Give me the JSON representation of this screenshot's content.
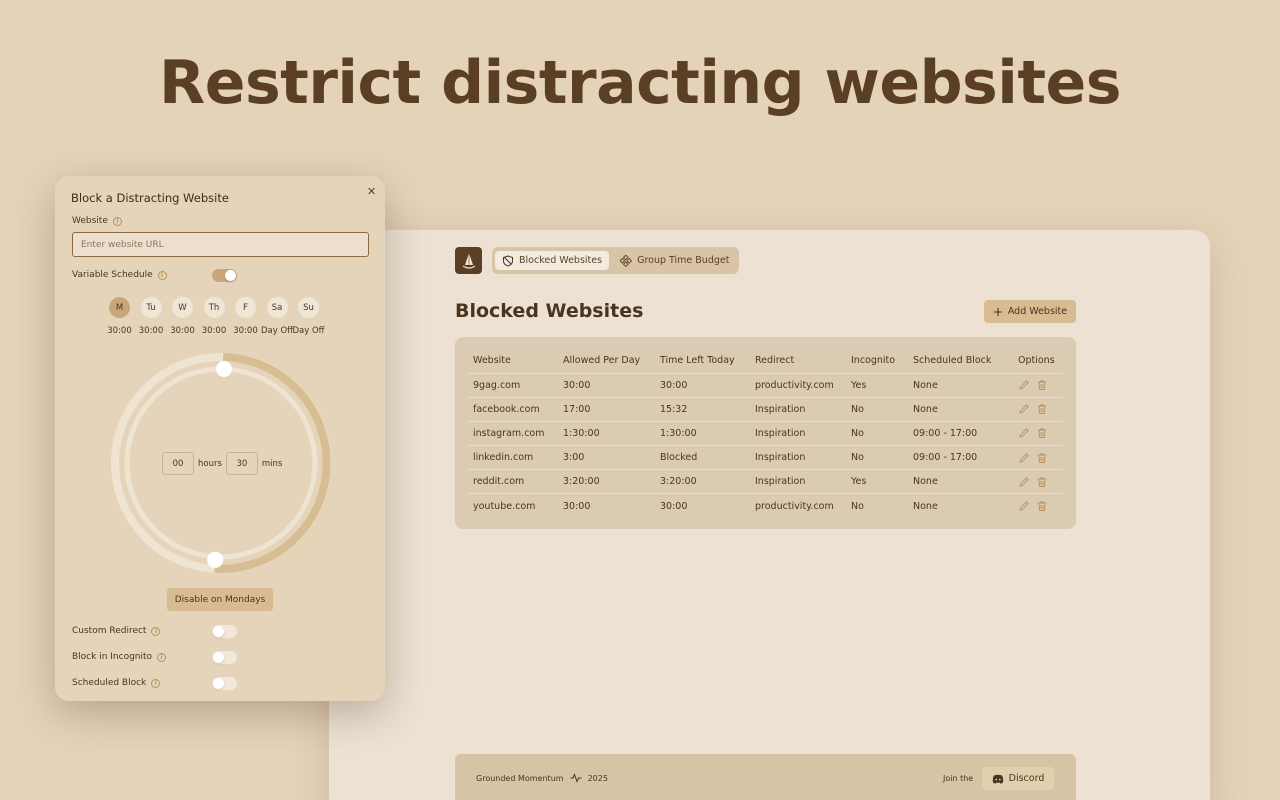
{
  "headline": "Restrict distracting websites",
  "nav": {
    "tabs": [
      {
        "label": "Blocked Websites",
        "icon": "shield-icon",
        "active": true
      },
      {
        "label": "Group Time Budget",
        "icon": "group-icon",
        "active": false
      }
    ]
  },
  "main": {
    "title": "Blocked Websites",
    "add_label": "Add Website",
    "table": {
      "headers": [
        "Website",
        "Allowed Per Day",
        "Time Left Today",
        "Redirect",
        "Incognito",
        "Scheduled Block",
        "Options"
      ],
      "rows": [
        [
          "9gag.com",
          "30:00",
          "30:00",
          "productivity.com",
          "Yes",
          "None"
        ],
        [
          "facebook.com",
          "17:00",
          "15:32",
          "Inspiration",
          "No",
          "None"
        ],
        [
          "instagram.com",
          "1:30:00",
          "1:30:00",
          "Inspiration",
          "No",
          "09:00 - 17:00"
        ],
        [
          "linkedin.com",
          "3:00",
          "Blocked",
          "Inspiration",
          "No",
          "09:00 - 17:00"
        ],
        [
          "reddit.com",
          "3:20:00",
          "3:20:00",
          "Inspiration",
          "Yes",
          "None"
        ],
        [
          "youtube.com",
          "30:00",
          "30:00",
          "productivity.com",
          "No",
          "None"
        ]
      ]
    }
  },
  "footer": {
    "brand": "Grounded Momentum",
    "year": "2025",
    "join": "Join the",
    "discord": "Discord"
  },
  "modal": {
    "title": "Block a Distracting Website",
    "website_label": "Website",
    "website_placeholder": "Enter website URL",
    "variable_schedule_label": "Variable Schedule",
    "variable_schedule_on": true,
    "days": [
      {
        "label": "M",
        "value": "30:00",
        "active": true
      },
      {
        "label": "Tu",
        "value": "30:00",
        "active": false
      },
      {
        "label": "W",
        "value": "30:00",
        "active": false
      },
      {
        "label": "Th",
        "value": "30:00",
        "active": false
      },
      {
        "label": "F",
        "value": "30:00",
        "active": false
      },
      {
        "label": "Sa",
        "value": "Day Off",
        "active": false
      },
      {
        "label": "Su",
        "value": "Day Off",
        "active": false
      }
    ],
    "hours_value": "00",
    "hours_label": "hours",
    "mins_value": "30",
    "mins_label": "mins",
    "dial_fraction": 0.5,
    "disable_label": "Disable on Mondays",
    "options": [
      {
        "label": "Custom Redirect",
        "on": false
      },
      {
        "label": "Block in Incognito",
        "on": false
      },
      {
        "label": "Scheduled Block",
        "on": false
      }
    ]
  },
  "colors": {
    "background": "#e5d3b9",
    "accent": "#d9bb92",
    "text": "#4a3420"
  }
}
